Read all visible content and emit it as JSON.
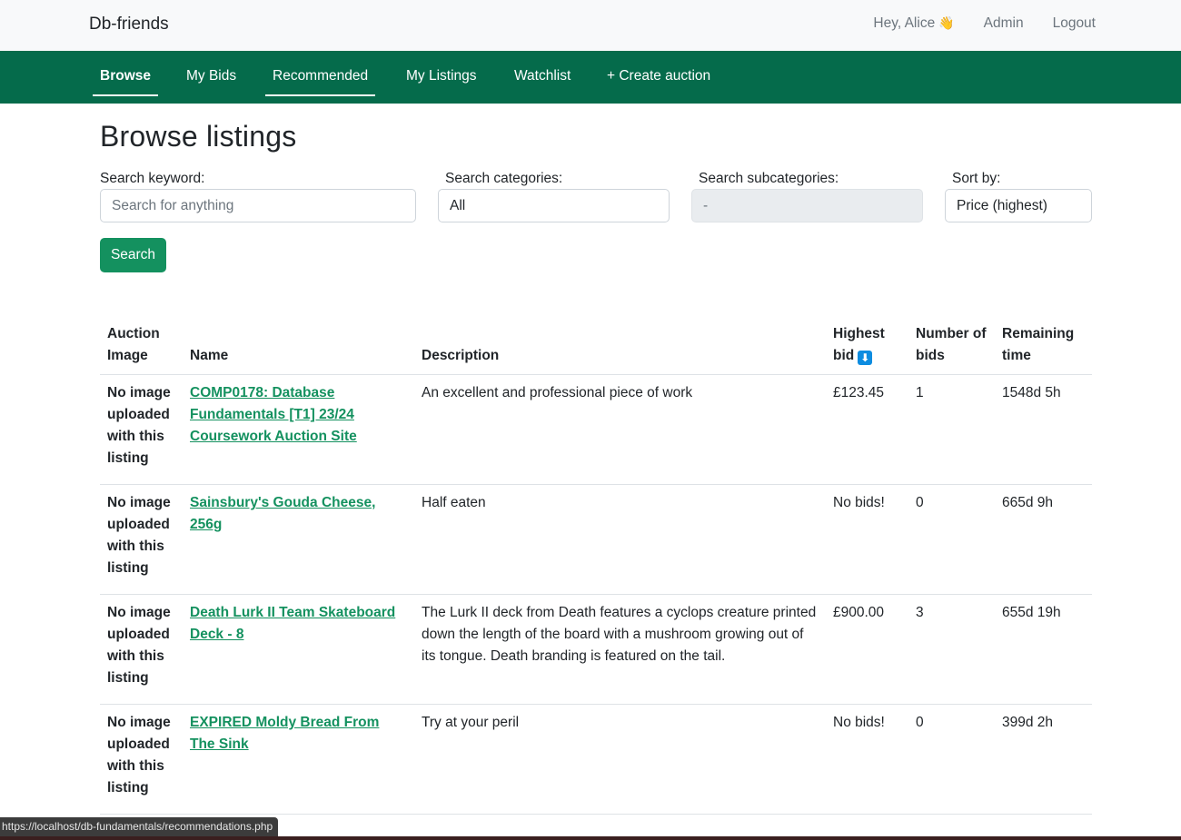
{
  "header": {
    "brand": "Db-friends",
    "greeting": "Hey, Alice",
    "greeting_emoji": "👋",
    "admin_label": "Admin",
    "logout_label": "Logout"
  },
  "nav": {
    "browse": "Browse",
    "my_bids": "My Bids",
    "recommended": "Recommended",
    "my_listings": "My Listings",
    "watchlist": "Watchlist",
    "create_auction": "+ Create auction"
  },
  "page": {
    "title": "Browse listings"
  },
  "filters": {
    "keyword_label": "Search keyword:",
    "keyword_placeholder": "Search for anything",
    "categories_label": "Search categories:",
    "categories_value": "All",
    "subcategories_label": "Search subcategories:",
    "subcategories_value": "-",
    "sort_label": "Sort by:",
    "sort_value": "Price (highest)",
    "search_button": "Search"
  },
  "table": {
    "headers": {
      "image": "Auction Image",
      "name": "Name",
      "description": "Description",
      "highest_bid": "Highest bid",
      "num_bids": "Number of bids",
      "remaining": "Remaining time"
    },
    "rows": [
      {
        "image": "No image uploaded with this listing",
        "name": "COMP0178: Database Fundamentals [T1] 23/24 Coursework Auction Site",
        "description": "An excellent and professional piece of work",
        "highest_bid": "£123.45",
        "num_bids": "1",
        "remaining": "1548d 5h"
      },
      {
        "image": "No image uploaded with this listing",
        "name": "Sainsbury's Gouda Cheese, 256g",
        "description": "Half eaten",
        "highest_bid": "No bids!",
        "num_bids": "0",
        "remaining": "665d 9h"
      },
      {
        "image": "No image uploaded with this listing",
        "name": "Death Lurk II Team Skateboard Deck - 8",
        "description": "The Lurk II deck from Death features a cyclops creature printed down the length of the board with a mushroom growing out of its tongue. Death branding is featured on the tail.",
        "highest_bid": "£900.00",
        "num_bids": "3",
        "remaining": "655d 19h"
      },
      {
        "image": "No image uploaded with this listing",
        "name": "EXPIRED Moldy Bread From The Sink",
        "description": "Try at your peril",
        "highest_bid": "No bids!",
        "num_bids": "0",
        "remaining": "399d 2h"
      }
    ]
  },
  "statusbar": {
    "url": "https://localhost/db-fundamentals/recommendations.php"
  }
}
